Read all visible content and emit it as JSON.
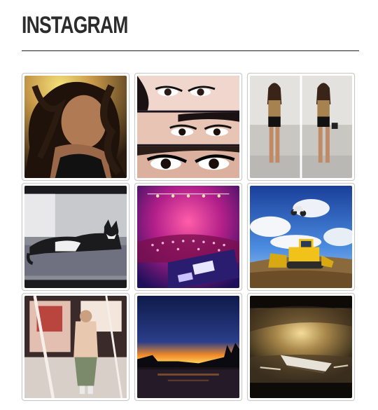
{
  "widget": {
    "title": "INSTAGRAM",
    "photos": [
      {
        "subject": "selfie-curly-hair-photo"
      },
      {
        "subject": "eye-makeup-collage-photo"
      },
      {
        "subject": "fashion-outfit-split-photo"
      },
      {
        "subject": "cat-on-sofa-photo"
      },
      {
        "subject": "concert-crowd-photo"
      },
      {
        "subject": "motocross-bulldozer-photo"
      },
      {
        "subject": "mirror-selfie-photo"
      },
      {
        "subject": "lake-sunset-photo"
      },
      {
        "subject": "boat-on-shore-photo"
      }
    ]
  }
}
